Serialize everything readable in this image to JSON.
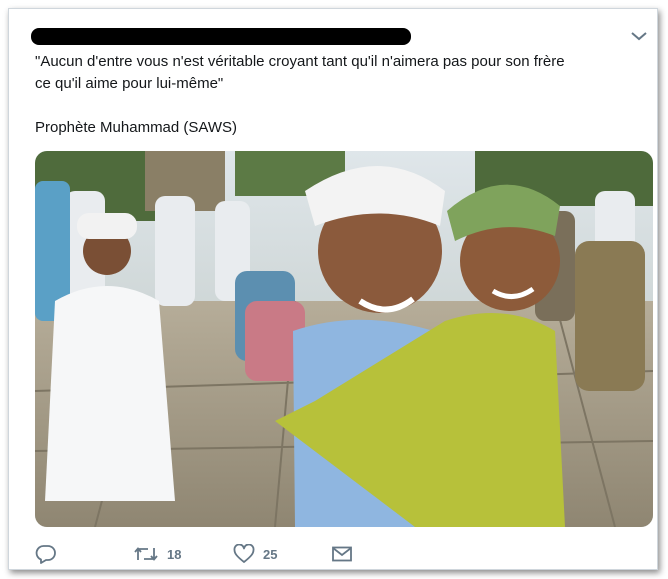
{
  "tweet": {
    "author_redacted": true,
    "text": "\"Aucun d'entre vous n'est véritable croyant tant qu'il n'aimera pas pour son frère\nce qu'il aime pour lui-même\"\n\nProphète Muhammad (SAWS)"
  },
  "actions": {
    "retweet_count": "18",
    "like_count": "25"
  },
  "icons": {
    "menu": "chevron-down-icon",
    "reply": "reply-icon",
    "retweet": "retweet-icon",
    "like": "heart-icon",
    "message": "envelope-icon"
  },
  "colors": {
    "icon": "#657786",
    "text": "#14171a"
  }
}
